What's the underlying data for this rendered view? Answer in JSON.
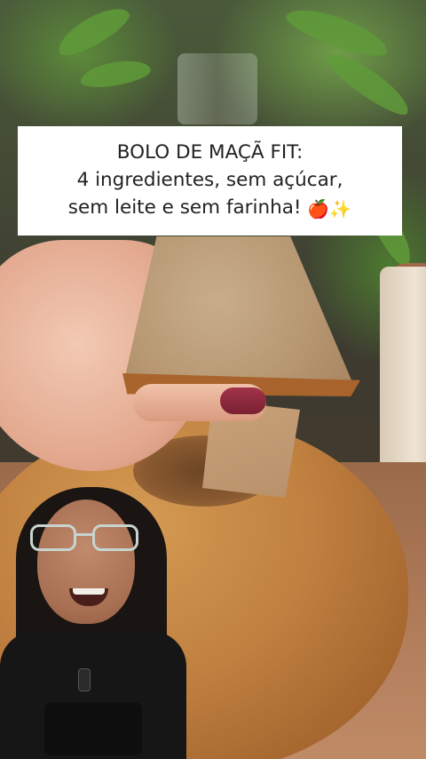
{
  "caption": {
    "line1": "BOLO DE MAÇÃ FIT:",
    "line2": "4 ingredientes, sem açúcar,",
    "line3": "sem leite e sem farinha!",
    "emoji_apple": "🍎",
    "emoji_sparkles": "✨"
  },
  "colors": {
    "caption_background": "#ffffff",
    "caption_text": "#222222"
  },
  "icons": [
    "apple-icon",
    "sparkles-icon"
  ]
}
